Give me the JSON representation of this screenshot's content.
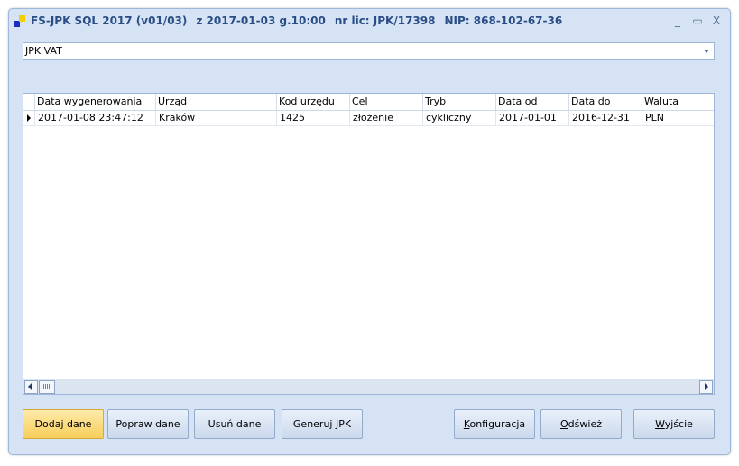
{
  "window": {
    "title_segments": [
      "FS-JPK SQL 2017 (v01/03)",
      "z 2017-01-03 g.10:00",
      "nr lic: JPK/17398",
      "NIP: 868-102-67-36"
    ],
    "controls": {
      "minimize": "_",
      "maximize": "▭",
      "close": "X"
    }
  },
  "selector": {
    "value": "JPK VAT"
  },
  "grid": {
    "columns": [
      "Data wygenerowania",
      "Urząd",
      "Kod urzędu",
      "Cel",
      "Tryb",
      "Data od",
      "Data do",
      "Waluta"
    ],
    "rows": [
      [
        "2017-01-08 23:47:12",
        "Kraków",
        "1425",
        "złożenie",
        "cykliczny",
        "2017-01-01",
        "2016-12-31",
        "PLN"
      ]
    ]
  },
  "buttons": {
    "add": "Dodaj dane",
    "edit": "Popraw dane",
    "delete": "Usuń dane",
    "generate": "Generuj JPK",
    "config_pre": "",
    "config_ul": "K",
    "config_post": "onfiguracja",
    "refresh_pre": "",
    "refresh_ul": "O",
    "refresh_post": "dśwież",
    "exit_pre": "",
    "exit_ul": "W",
    "exit_post": "yjście"
  },
  "colors": {
    "primary_button": "#f8cf5c",
    "title_text": "#2a4d85",
    "window_bg": "#d5e3f5"
  }
}
